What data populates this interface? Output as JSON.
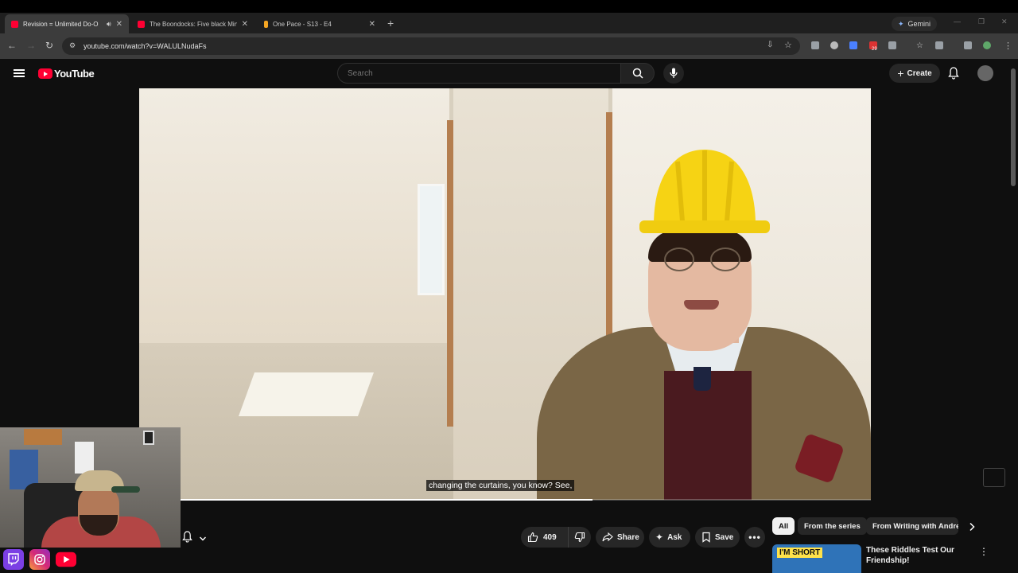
{
  "browser": {
    "tabs": [
      {
        "title": "Revision = Unlimited Do-O",
        "favicon_color": "#ff0033",
        "active": true
      },
      {
        "title": "The Boondocks: Five black Min",
        "favicon_color": "#ff0033",
        "active": false
      },
      {
        "title": "One Pace - S13 - E4",
        "favicon_color": "#f5a623",
        "active": false
      }
    ],
    "gemini_label": "Gemini",
    "url": "youtube.com/watch?v=WALULNudaFs",
    "extension_badge": "29"
  },
  "youtube": {
    "logo_text": "YouTube",
    "search_placeholder": "Search",
    "create_label": "Create"
  },
  "video": {
    "caption": "changing the curtains, you know? See,",
    "progress_fraction": 0.62
  },
  "actions": {
    "like_count": "409",
    "share_label": "Share",
    "ask_label": "Ask",
    "save_label": "Save"
  },
  "chips": [
    "All",
    "From the series",
    "From Writing with Andrew"
  ],
  "recommendation": {
    "thumb_text": "I'M SHORT",
    "title": "These Riddles Test Our Friendship!"
  },
  "colors": {
    "accent": "#ff0033",
    "background": "#0f0f0f"
  }
}
